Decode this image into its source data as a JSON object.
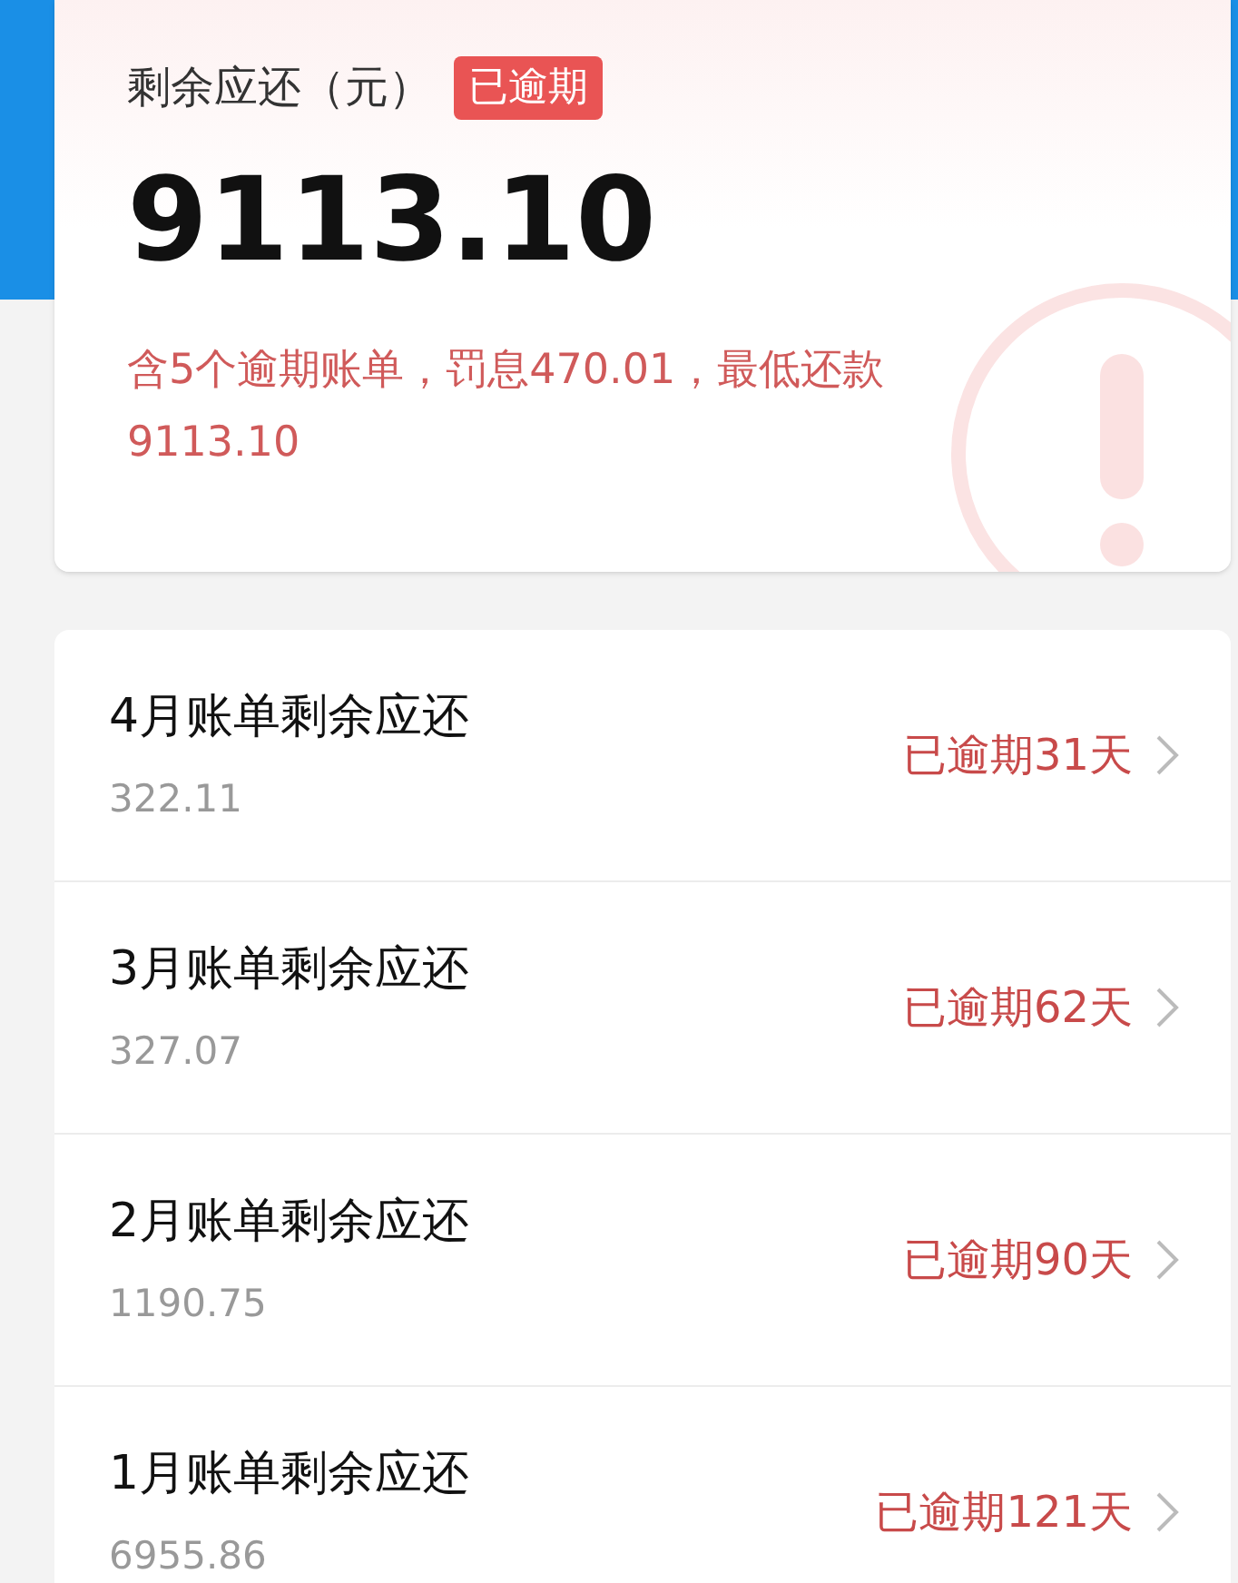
{
  "summary": {
    "label": "剩余应还（元）",
    "badge": "已逾期",
    "amount": "9113.10",
    "note": "含5个逾期账单，罚息470.01，最低还款9113.10"
  },
  "bills": [
    {
      "title": "4月账单剩余应还",
      "amount": "322.11",
      "status": "已逾期31天"
    },
    {
      "title": "3月账单剩余应还",
      "amount": "327.07",
      "status": "已逾期62天"
    },
    {
      "title": "2月账单剩余应还",
      "amount": "1190.75",
      "status": "已逾期90天"
    },
    {
      "title": "1月账单剩余应还",
      "amount": "6955.86",
      "status": "已逾期121天"
    }
  ]
}
